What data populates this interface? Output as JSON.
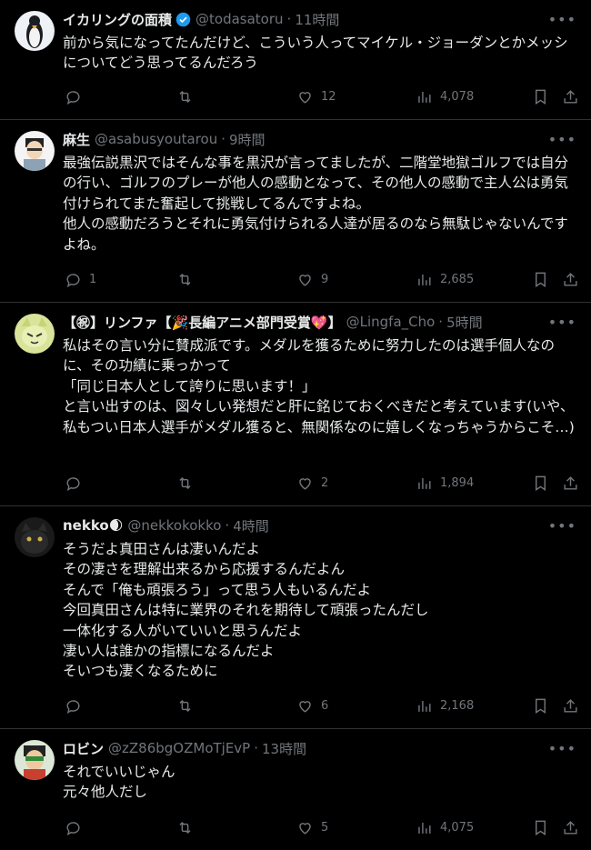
{
  "tweets": [
    {
      "name": "イカリングの面積",
      "verified": true,
      "handle": "@todasatoru",
      "sep": "·",
      "time": "11時間",
      "text": "前から気になってたんだけど、こういう人ってマイケル・ジョーダンとかメッシについてどう思ってるんだろう",
      "replies": "",
      "retweets": "",
      "likes": "12",
      "views": "4,078"
    },
    {
      "name": "麻生",
      "handle": "@asabusyoutarou",
      "sep": "·",
      "time": "9時間",
      "text": "最強伝説黒沢ではそんな事を黒沢が言ってましたが、二階堂地獄ゴルフでは自分の行い、ゴルフのプレーが他人の感動となって、その他人の感動で主人公は勇気付けられてまた奮起して挑戦してるんですよね。\n他人の感動だろうとそれに勇気付けられる人達が居るのなら無駄じゃないんですよね。",
      "replies": "1",
      "retweets": "",
      "likes": "9",
      "views": "2,685"
    },
    {
      "name": "【㊗】リンファ【🎉長編アニメ部門受賞💖】",
      "handle": "@Lingfa_Cho",
      "sep": "·",
      "time": "5時間",
      "text": "私はその言い分に賛成派です。メダルを獲るために努力したのは選手個人なのに、その功績に乗っかって\n「同じ日本人として誇りに思います！」\nと言い出すのは、図々しい発想だと肝に銘じておくべきだと考えています(いや、私もつい日本人選手がメダル獲ると、無関係なのに嬉しくなっちゃうからこそ…)",
      "replies": "",
      "retweets": "",
      "likes": "2",
      "views": "1,894"
    },
    {
      "name": "nekko🌒",
      "handle": "@nekkokokko",
      "sep": "·",
      "time": "4時間",
      "text": "そうだよ真田さんは凄いんだよ\nその凄さを理解出来るから応援するんだよん\nそんで「俺も頑張ろう」って思う人もいるんだよ\n今回真田さんは特に業界のそれを期待して頑張ったんだし\n一体化する人がいていいと思うんだよ\n凄い人は誰かの指標になるんだよ\nそいつも凄くなるために",
      "replies": "",
      "retweets": "",
      "likes": "6",
      "views": "2,168"
    },
    {
      "name": "ロビン",
      "handle": "@zZ86bgOZMoTjEvP",
      "sep": "·",
      "time": "13時間",
      "text": "それでいいじゃん\n元々他人だし",
      "replies": "",
      "retweets": "",
      "likes": "5",
      "views": "4,075"
    }
  ],
  "colors": {
    "background": "#000000",
    "text": "#e7e9ea",
    "muted": "#71767b",
    "border": "#2f3336",
    "verified": "#1d9bf0"
  },
  "icons": [
    "reply-icon",
    "retweet-icon",
    "like-icon",
    "views-icon",
    "bookmark-icon",
    "share-icon",
    "more-icon",
    "verified-badge-icon"
  ]
}
